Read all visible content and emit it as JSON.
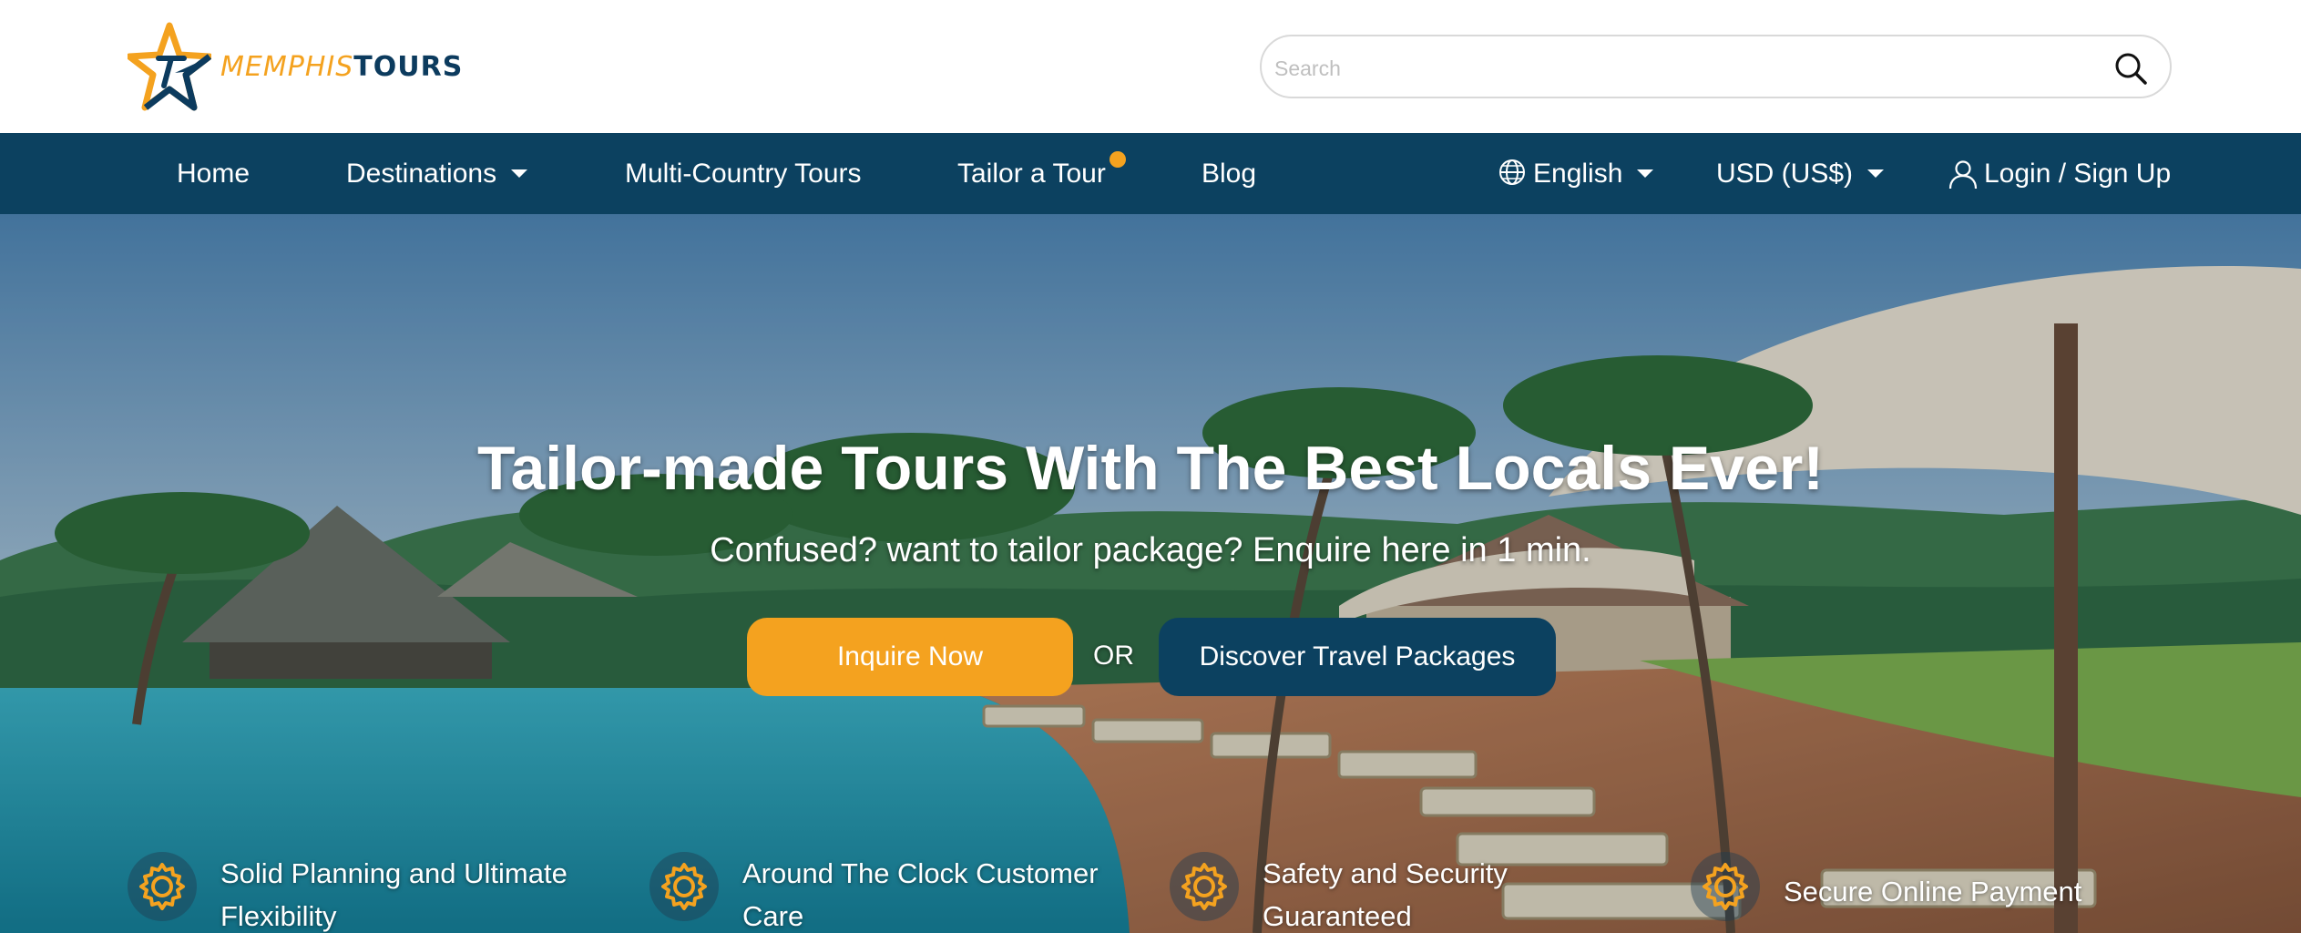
{
  "header": {
    "logo": {
      "word1": "MEMPHIS",
      "word2": "TOURS"
    },
    "search": {
      "placeholder": "Search"
    }
  },
  "nav": {
    "items": [
      {
        "label": "Home"
      },
      {
        "label": "Destinations",
        "has_dropdown": true
      },
      {
        "label": "Multi-Country Tours"
      },
      {
        "label": "Tailor a Tour",
        "has_badge_dot": true
      },
      {
        "label": "Blog"
      }
    ],
    "language": "English",
    "currency": "USD (US$)",
    "login": "Login / Sign Up"
  },
  "hero": {
    "title": "Tailor-made Tours With The Best Locals Ever!",
    "subtitle": "Confused? want to tailor package? Enquire here in 1 min.",
    "inquire_button": "Inquire Now",
    "or_text": "OR",
    "discover_button": "Discover Travel Packages"
  },
  "features": [
    {
      "line1": "Solid Planning and Ultimate",
      "line2": "Flexibility",
      "icon": "gear-icon"
    },
    {
      "line1": "Around The Clock Customer",
      "line2": "Care",
      "icon": "gear-icon"
    },
    {
      "line1": "Safety and Security",
      "line2": "Guaranteed",
      "icon": "gear-icon"
    },
    {
      "line1": "Secure Online Payment",
      "line2": "",
      "icon": "gear-icon"
    }
  ],
  "colors": {
    "brand_orange": "#f4a21f",
    "brand_navy": "#0c4160",
    "white": "#ffffff"
  }
}
